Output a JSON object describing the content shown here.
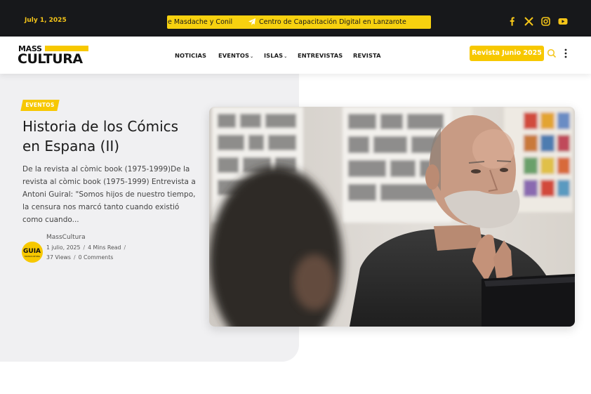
{
  "topbar": {
    "date": "July 1, 2025",
    "ticker_left": "e Masdache y Conil",
    "ticker_right": "Centro de Capacitación Digital en Lanzarote",
    "social_icons": [
      "facebook-icon",
      "x-icon",
      "instagram-icon",
      "youtube-icon"
    ]
  },
  "navbar": {
    "logo_top": "MASS",
    "logo_bottom": "CULTURA",
    "items": [
      {
        "label": "NOTICIAS",
        "dropdown": false
      },
      {
        "label": "EVENTOS",
        "dropdown": true
      },
      {
        "label": "ISLAS",
        "dropdown": true
      },
      {
        "label": "ENTREVISTAS",
        "dropdown": false
      },
      {
        "label": "REVISTA",
        "dropdown": false
      }
    ],
    "cta_label": "Revista Junio 2025"
  },
  "article": {
    "category": "EVENTOS",
    "title": "Historia de los Cómics en Espana (II)",
    "excerpt": "De la revista al còmic book (1975-1999)De la revista al còmic book (1975-1999) Entrevista a Antoni Guiral: \"Somos hijos de nuestro tiempo, la censura nos marcó tanto cuando existió como cuando...",
    "author": "MassCultura",
    "author_logo_text": "GUIA",
    "author_logo_sub": "MASSCULTURA",
    "date": "1 julio, 2025",
    "read_time": "4 Mins Read",
    "views": "37 Views",
    "comments": "0 Comments"
  },
  "colors": {
    "accent": "#f7c800",
    "topbar_bg": "#17181b",
    "hero_bg": "#f0f0f2"
  }
}
